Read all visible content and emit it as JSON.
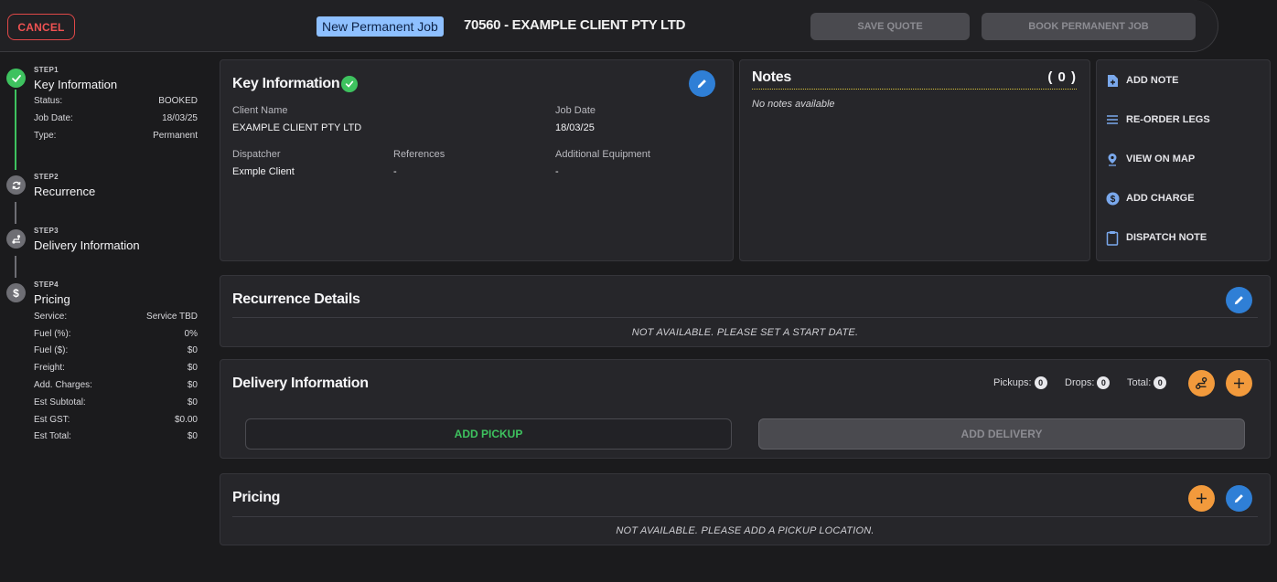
{
  "header": {
    "cancel_label": "CANCEL",
    "job_badge": "New Permanent Job",
    "job_title": "70560 - EXAMPLE CLIENT PTY LTD",
    "save_quote_label": "SAVE QUOTE",
    "book_job_label": "BOOK PERMANENT JOB"
  },
  "steps": [
    {
      "step_label": "STEP1",
      "title": "Key Information",
      "icon": "check-icon",
      "status": "done",
      "details": [
        {
          "key": "Status:",
          "value": "BOOKED"
        },
        {
          "key": "Job Date:",
          "value": "18/03/25"
        },
        {
          "key": "Type:",
          "value": "Permanent"
        }
      ]
    },
    {
      "step_label": "STEP2",
      "title": "Recurrence",
      "icon": "refresh-icon",
      "status": "todo"
    },
    {
      "step_label": "STEP3",
      "title": "Delivery Information",
      "icon": "route-icon",
      "status": "todo"
    },
    {
      "step_label": "STEP4",
      "title": "Pricing",
      "icon": "dollar-icon",
      "status": "todo",
      "details": [
        {
          "key": "Service:",
          "value": "Service TBD"
        },
        {
          "key": "Fuel (%):",
          "value": "0%"
        },
        {
          "key": "Fuel ($):",
          "value": "$0"
        },
        {
          "key": "Freight:",
          "value": "$0"
        },
        {
          "key": "Add. Charges:",
          "value": "$0"
        },
        {
          "key": "Est Subtotal:",
          "value": "$0"
        },
        {
          "key": "Est GST:",
          "value": "$0.00"
        },
        {
          "key": "Est Total:",
          "value": "$0"
        }
      ]
    }
  ],
  "key_info": {
    "title": "Key Information",
    "client_name_label": "Client Name",
    "client_name": "EXAMPLE CLIENT PTY LTD",
    "job_date_label": "Job Date",
    "job_date": "18/03/25",
    "dispatcher_label": "Dispatcher",
    "dispatcher": "Exmple Client",
    "references_label": "References",
    "references": "-",
    "equipment_label": "Additional Equipment",
    "equipment": "-"
  },
  "notes": {
    "title": "Notes",
    "count": "( 0 )",
    "empty": "No notes available"
  },
  "actions": [
    {
      "label": "ADD NOTE",
      "icon": "note-add-icon"
    },
    {
      "label": "RE-ORDER LEGS",
      "icon": "reorder-icon"
    },
    {
      "label": "VIEW ON MAP",
      "icon": "map-pin-icon"
    },
    {
      "label": "ADD CHARGE",
      "icon": "dollar-circle-icon"
    },
    {
      "label": "DISPATCH NOTE",
      "icon": "clipboard-icon"
    }
  ],
  "recurrence": {
    "title": "Recurrence Details",
    "message": "NOT AVAILABLE. PLEASE SET A START DATE."
  },
  "delivery": {
    "title": "Delivery Information",
    "pickups_label": "Pickups:",
    "pickups": "0",
    "drops_label": "Drops:",
    "drops": "0",
    "total_label": "Total:",
    "total": "0",
    "add_pickup_label": "ADD PICKUP",
    "add_delivery_label": "ADD DELIVERY"
  },
  "pricing": {
    "title": "Pricing",
    "message": "NOT AVAILABLE. PLEASE ADD A PICKUP LOCATION."
  },
  "colors": {
    "background": "#1b1b1d",
    "card": "#26262a",
    "success_green": "#3ec25f",
    "accent_blue": "#2f7fd6",
    "accent_orange": "#f29a3c",
    "danger_red": "#f05252",
    "badge_blue": "#8ec0ff"
  }
}
